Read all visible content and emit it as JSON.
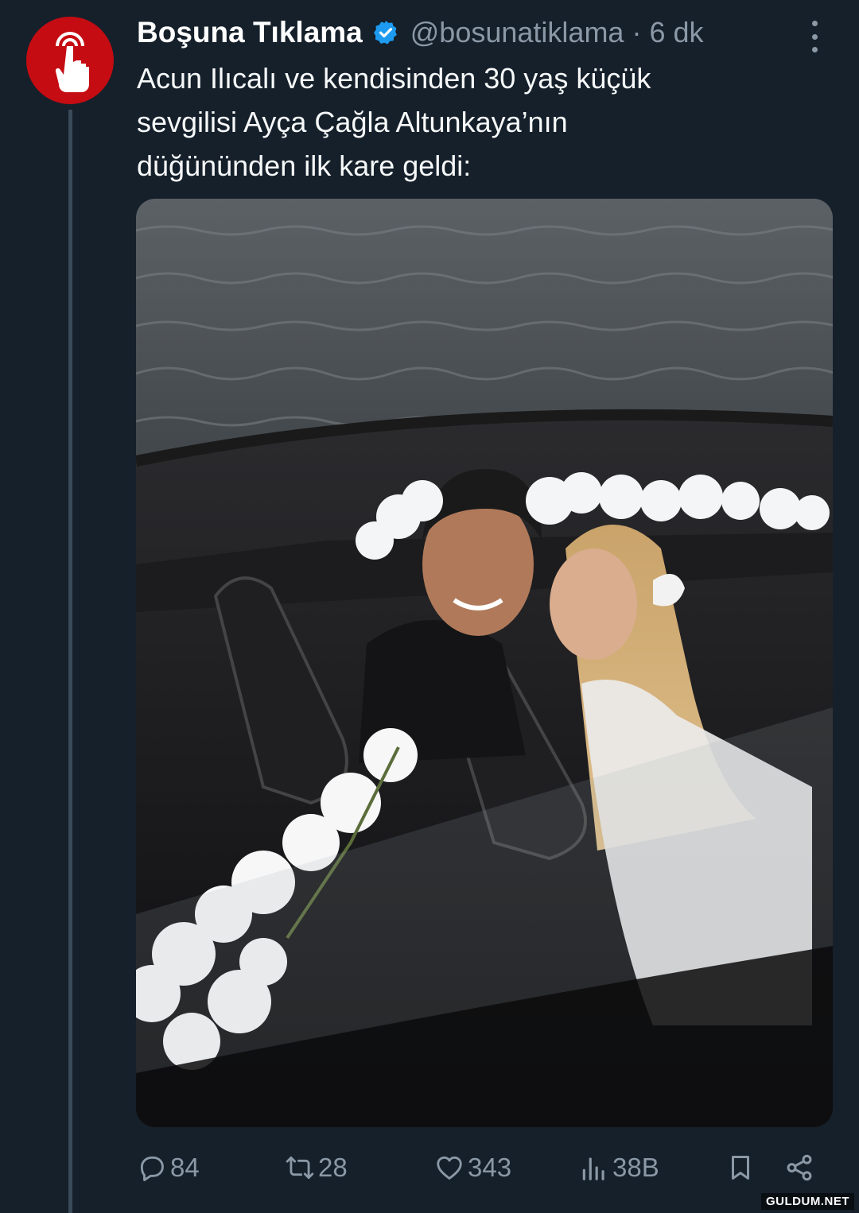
{
  "author": {
    "display_name": "Boşuna Tıklama",
    "handle": "@bosunatiklama",
    "separator": "·",
    "time": "6 dk",
    "verified_icon": "verified-badge-icon",
    "brand_color": "#c40c12"
  },
  "tweet": {
    "lines": [
      "Acun Ilıcalı ve kendisinden 30 yaş küçük",
      "sevgilisi Ayça Çağla Altunkaya’nın",
      "düğününden ilk kare geldi:"
    ]
  },
  "actions": {
    "replies": "84",
    "retweets": "28",
    "likes": "343",
    "views": "38B"
  },
  "watermark": "GULDUM.NET",
  "colors": {
    "background": "#15202b",
    "secondary_text": "#8b98a5",
    "verified": "#1d9bf0"
  }
}
